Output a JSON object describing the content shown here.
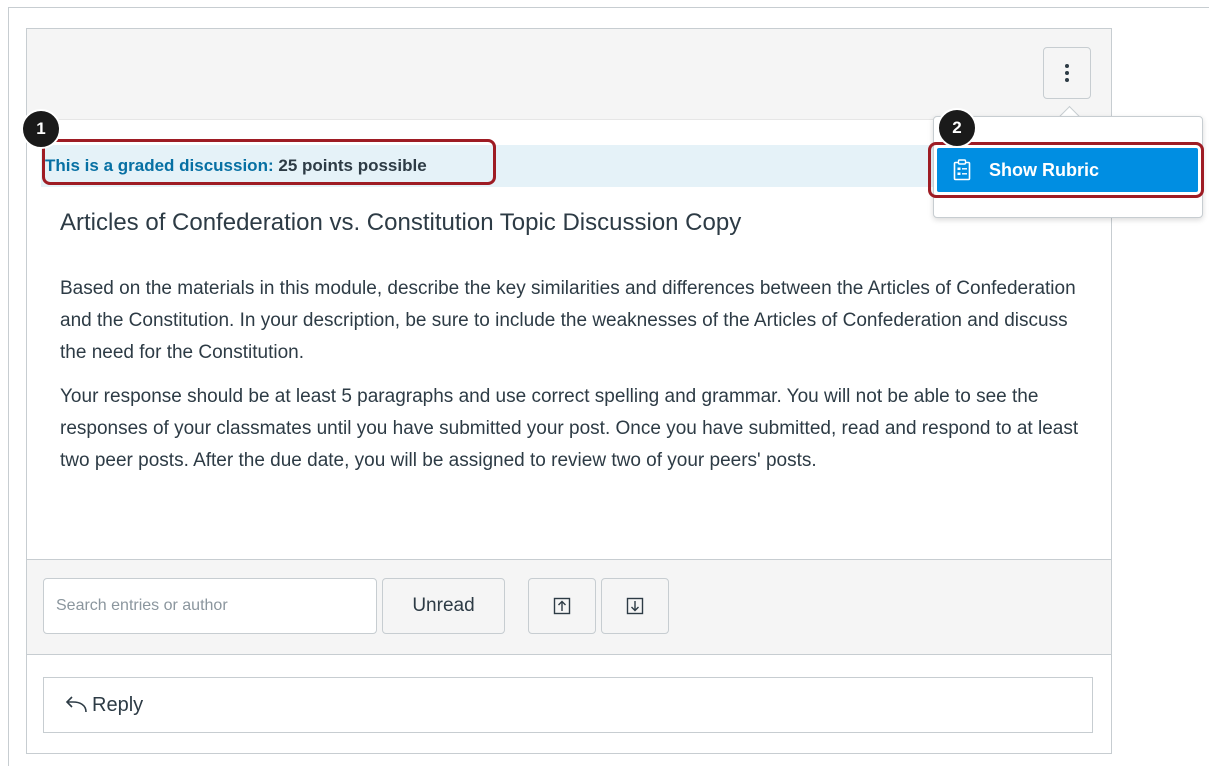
{
  "graded_banner": {
    "label": "This is a graded discussion:",
    "points": "25 points possible"
  },
  "topic": {
    "title": "Articles of Confederation vs. Constitution Topic Discussion Copy",
    "paragraphs": [
      "Based on the materials in this module, describe the key similarities and differences between the Articles of Confederation and the Constitution. In your description, be sure to include the weaknesses of the Articles of Confederation and discuss the need for the Constitution.",
      "Your response should be at least 5 paragraphs and use correct spelling and grammar. You will not be able to see the responses of your classmates until you have submitted your post. Once you have submitted, read and respond to at least two peer posts. After the due date, you will be assigned to review two of your peers' posts."
    ]
  },
  "toolbar": {
    "search_placeholder": "Search entries or author",
    "unread_label": "Unread",
    "collapse_icon": "collapse-replies-icon",
    "expand_icon": "expand-replies-icon"
  },
  "reply": {
    "label": "Reply",
    "icon": "reply-arrow-icon"
  },
  "options_menu": {
    "trigger_icon": "kebab-menu-icon",
    "items": [
      {
        "label": "Show Rubric",
        "icon": "clipboard-rubric-icon"
      }
    ]
  },
  "annotations": {
    "step_1": "1",
    "step_2": "2"
  },
  "colors": {
    "accent": "#008ee2",
    "link": "#0770a3",
    "highlight_outline": "#9e1c24",
    "banner_bg": "#e5f2f8",
    "text": "#2d3b45"
  }
}
